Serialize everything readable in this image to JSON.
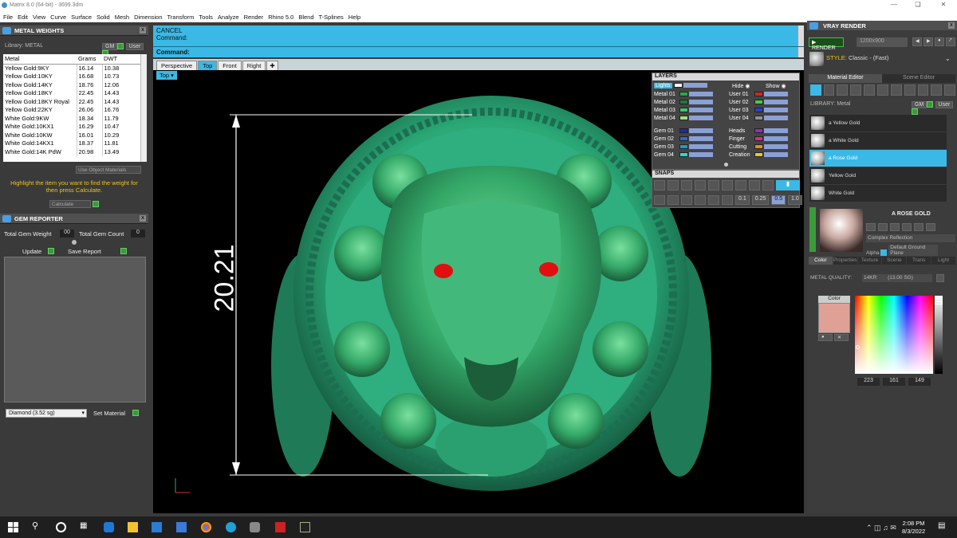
{
  "window": {
    "title": "Matrix 8.0 (64-bit) - 3699.3dm"
  },
  "menu": [
    "File",
    "Edit",
    "View",
    "Curve",
    "Surface",
    "Solid",
    "Mesh",
    "Dimension",
    "Transform",
    "Tools",
    "Analyze",
    "Render",
    "Rhino 5.0",
    "Blend",
    "T-Splines",
    "Help"
  ],
  "metal_weights": {
    "title": "METAL WEIGHTS",
    "library_label": "Library: METAL",
    "gm_label": "GM",
    "user_label": "User",
    "columns": [
      "Metal",
      "Grams",
      "DWT"
    ],
    "rows": [
      [
        "Yellow Gold:9KY",
        "16.14",
        "10.38"
      ],
      [
        "Yellow Gold:10KY",
        "16.68",
        "10.73"
      ],
      [
        "Yellow Gold:14KY",
        "18.76",
        "12.06"
      ],
      [
        "Yellow Gold:18KY",
        "22.45",
        "14.43"
      ],
      [
        "Yellow Gold:18KY Royal",
        "22.45",
        "14.43"
      ],
      [
        "Yellow Gold:22KY",
        "26.06",
        "16.76"
      ],
      [
        "White Gold:9KW",
        "18.34",
        "11.79"
      ],
      [
        "White Gold:10KX1",
        "16.29",
        "10.47"
      ],
      [
        "White Gold:10KW",
        "16.01",
        "10.29"
      ],
      [
        "White Gold:14KX1",
        "18.37",
        "11.81"
      ],
      [
        "White Gold:14K PdW",
        "20.98",
        "13.49"
      ]
    ],
    "use_object_materials": "Use Object Materials",
    "hint": "Highlight the item you want to find the weight for then press Calculate.",
    "calculate": "Calculate"
  },
  "gem_reporter": {
    "title": "GEM REPORTER",
    "total_weight_label": "Total Gem Weight",
    "total_weight_value": "00",
    "total_count_label": "Total Gem Count",
    "total_count_value": "0",
    "update": "Update",
    "save_report": "Save Report",
    "gem_select": "Diamond      (3.52 sg)",
    "set_material": "Set Material"
  },
  "command": {
    "line1": "CANCEL",
    "line2": "Command:",
    "prompt": "Command:"
  },
  "tabs": [
    "Perspective",
    "Top",
    "Front",
    "Right"
  ],
  "viewport": {
    "label": "Top",
    "dimension": "20.21"
  },
  "layers": {
    "title": "LAYERS",
    "lights": "Lights",
    "hide": "Hide",
    "show": "Show",
    "left": [
      {
        "name": "Metal 01",
        "color": "#2aa84a"
      },
      {
        "name": "Metal 02",
        "color": "#1e7a3a"
      },
      {
        "name": "Metal 03",
        "color": "#37c86a"
      },
      {
        "name": "Metal 04",
        "color": "#9de07a"
      },
      {
        "name": "Gem 01",
        "color": "#1a2ab8"
      },
      {
        "name": "Gem 02",
        "color": "#2a6ad8"
      },
      {
        "name": "Gem 03",
        "color": "#1a9ac8"
      },
      {
        "name": "Gem 04",
        "color": "#2ad8d0"
      }
    ],
    "right": [
      {
        "name": "User 01",
        "color": "#e02020"
      },
      {
        "name": "User 02",
        "color": "#40d040"
      },
      {
        "name": "User 03",
        "color": "#2040e0"
      },
      {
        "name": "User 04",
        "color": "#909090"
      },
      {
        "name": "Heads",
        "color": "#9a2ab8"
      },
      {
        "name": "Finger",
        "color": "#d82a8a"
      },
      {
        "name": "Cutting",
        "color": "#e88a20"
      },
      {
        "name": "Creation",
        "color": "#e8c820"
      }
    ]
  },
  "snaps": {
    "title": "SNAPS",
    "values": [
      "0.1",
      "0.25",
      "0.5",
      "1.0"
    ]
  },
  "vray": {
    "title": "VRAY RENDER",
    "render": "RENDER",
    "resolution": "1200x900",
    "style_label": "STYLE:",
    "style_value": "Classic - (Fast)",
    "material_tab": "Material Editor",
    "scene_tab": "Scene Editor",
    "library_label": "LIBRARY: Metal",
    "gm_label": "GM",
    "user_label": "User",
    "materials": [
      "a Yellow Gold",
      "a White Gold",
      "a Rose Gold",
      "Yellow Gold",
      "White Gold"
    ],
    "selected_material": "a Rose Gold",
    "material_title": "A ROSE GOLD",
    "reflection": "Complex Reflection",
    "alpha_label": "Alpha",
    "alpha_value": "Default Ground Plane",
    "subtabs": [
      "Color",
      "Properties",
      "Texture",
      "Scene",
      "Trans",
      "Light"
    ],
    "metal_quality_label": "METAL QUALITY:",
    "metal_quality_value": "14KR",
    "metal_quality_extra": "(13.00 SG)",
    "color_label": "Color",
    "rgb": [
      "223",
      "161",
      "149"
    ],
    "swatch": "#dfa195"
  },
  "taskbar": {
    "time": "2:08 PM",
    "date": "8/3/2022"
  },
  "colors": {
    "accent": "#3bb9e6",
    "model": "#2aa876",
    "eyes": "#e01010"
  }
}
